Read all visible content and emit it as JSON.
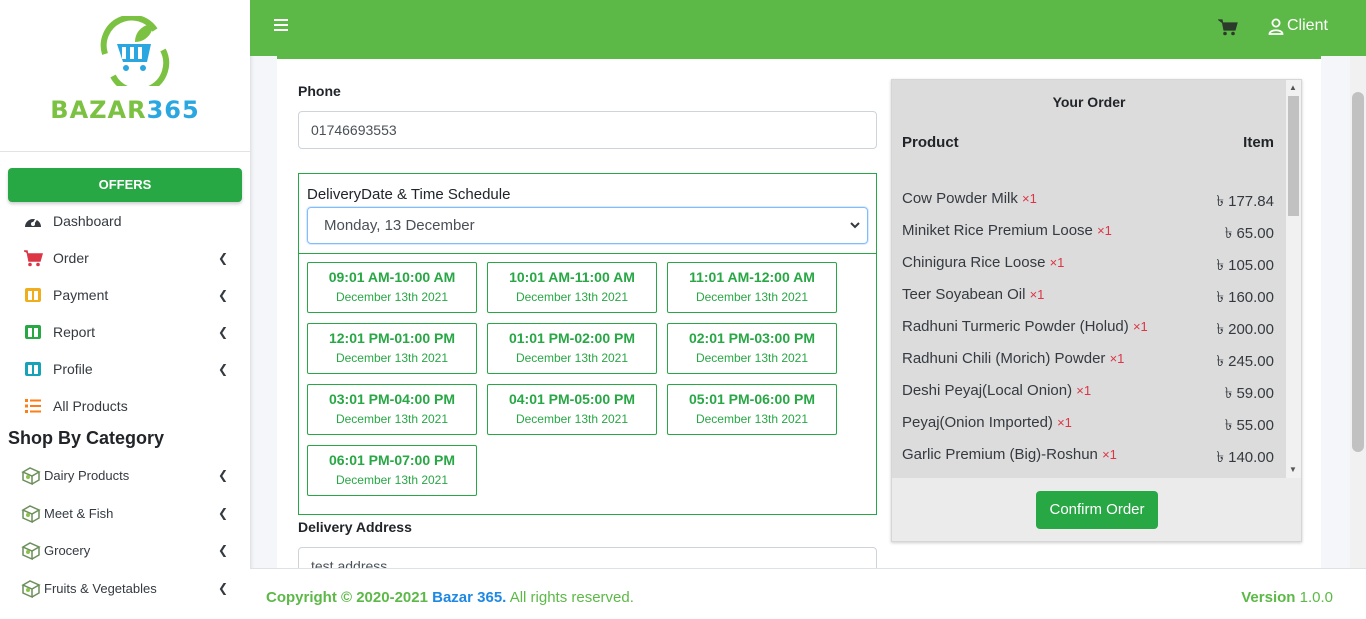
{
  "brand": {
    "name_part1": "BAZAR",
    "name_part2": "365"
  },
  "sidebar": {
    "offers_label": "OFFERS",
    "nav": [
      {
        "label": "Dashboard",
        "icon": "dashboard-icon"
      },
      {
        "label": "Order",
        "icon": "cart-icon"
      },
      {
        "label": "Payment",
        "icon": "payment-icon"
      },
      {
        "label": "Report",
        "icon": "report-icon"
      },
      {
        "label": "Profile",
        "icon": "profile-icon"
      },
      {
        "label": "All Products",
        "icon": "list-icon"
      }
    ],
    "category_title": "Shop By Category",
    "categories": [
      {
        "label": "Dairy Products",
        "icon": "category-icon"
      },
      {
        "label": "Meet & Fish",
        "icon": "category-icon"
      },
      {
        "label": "Grocery",
        "icon": "category-icon"
      },
      {
        "label": "Fruits & Vegetables",
        "icon": "category-icon"
      }
    ]
  },
  "header": {
    "client_label": "Client"
  },
  "form": {
    "phone_label": "Phone",
    "phone_value": "01746693553",
    "schedule_label": "DeliveryDate & Time Schedule",
    "schedule_selected": "Monday, 13 December",
    "slots": [
      {
        "time": "09:01 AM-10:00 AM",
        "date": "December 13th 2021"
      },
      {
        "time": "10:01 AM-11:00 AM",
        "date": "December 13th 2021"
      },
      {
        "time": "11:01 AM-12:00 AM",
        "date": "December 13th 2021"
      },
      {
        "time": "12:01 PM-01:00 PM",
        "date": "December 13th 2021"
      },
      {
        "time": "01:01 PM-02:00 PM",
        "date": "December 13th 2021"
      },
      {
        "time": "02:01 PM-03:00 PM",
        "date": "December 13th 2021"
      },
      {
        "time": "03:01 PM-04:00 PM",
        "date": "December 13th 2021"
      },
      {
        "time": "04:01 PM-05:00 PM",
        "date": "December 13th 2021"
      },
      {
        "time": "05:01 PM-06:00 PM",
        "date": "December 13th 2021"
      },
      {
        "time": "06:01 PM-07:00 PM",
        "date": "December 13th 2021"
      }
    ],
    "address_label": "Delivery Address",
    "address_value": "test address"
  },
  "order": {
    "title": "Your Order",
    "col_product": "Product",
    "col_item": "Item",
    "items": [
      {
        "name": "Cow Powder Milk",
        "qty": "×1",
        "price": "৳ 177.84"
      },
      {
        "name": "Miniket Rice Premium Loose",
        "qty": "×1",
        "price": "৳ 65.00"
      },
      {
        "name": "Chinigura Rice Loose",
        "qty": "×1",
        "price": "৳ 105.00"
      },
      {
        "name": "Teer Soyabean Oil",
        "qty": "×1",
        "price": "৳ 160.00"
      },
      {
        "name": "Radhuni Turmeric Powder (Holud)",
        "qty": "×1",
        "price": "৳ 200.00"
      },
      {
        "name": "Radhuni Chili (Morich) Powder",
        "qty": "×1",
        "price": "৳ 245.00"
      },
      {
        "name": "Deshi Peyaj(Local Onion)",
        "qty": "×1",
        "price": "৳ 59.00"
      },
      {
        "name": "Peyaj(Onion Imported)",
        "qty": "×1",
        "price": "৳ 55.00"
      },
      {
        "name": "Garlic Premium (Big)-Roshun",
        "qty": "×1",
        "price": "৳ 140.00"
      }
    ],
    "confirm_label": "Confirm Order"
  },
  "footer": {
    "copyright": "Copyright © 2020-2021",
    "brand_link": "Bazar 365.",
    "rights": "All rights reserved.",
    "version_label": "Version",
    "version_value": "1.0.0"
  },
  "colors": {
    "brand_green": "#5cb947",
    "button_green": "#28a745",
    "link_blue": "#1e88e5",
    "qty_red": "#dc3545"
  }
}
